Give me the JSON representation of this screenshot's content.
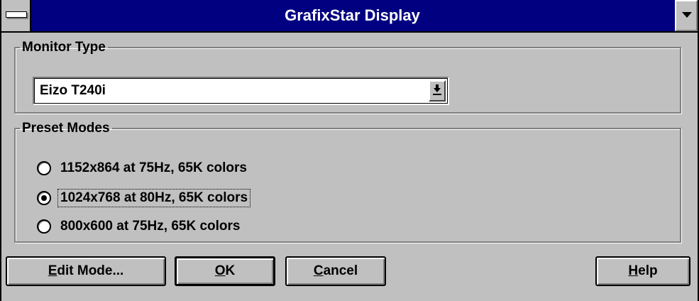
{
  "window": {
    "title": "GrafixStar Display"
  },
  "monitor_type": {
    "legend": "Monitor Type",
    "selected": "Eizo T240i"
  },
  "preset_modes": {
    "legend": "Preset Modes",
    "options": [
      {
        "label": "1152x864 at 75Hz,  65K colors",
        "selected": false
      },
      {
        "label": "1024x768 at 80Hz,  65K colors",
        "selected": true
      },
      {
        "label": "800x600 at 75Hz,  65K colors",
        "selected": false
      }
    ]
  },
  "buttons": {
    "edit_mode": {
      "mnemonic": "E",
      "rest": "dit Mode..."
    },
    "ok": {
      "mnemonic": "O",
      "rest": "K"
    },
    "cancel": {
      "mnemonic": "C",
      "rest": "ancel"
    },
    "help": {
      "mnemonic": "H",
      "rest": "elp"
    }
  },
  "icons": {
    "system_menu": "system-menu-icon",
    "minimize": "minimize-arrow-icon",
    "dropdown": "dropdown-arrow-icon"
  },
  "colors": {
    "titlebar": "#000080",
    "face": "#c0c0c0"
  }
}
